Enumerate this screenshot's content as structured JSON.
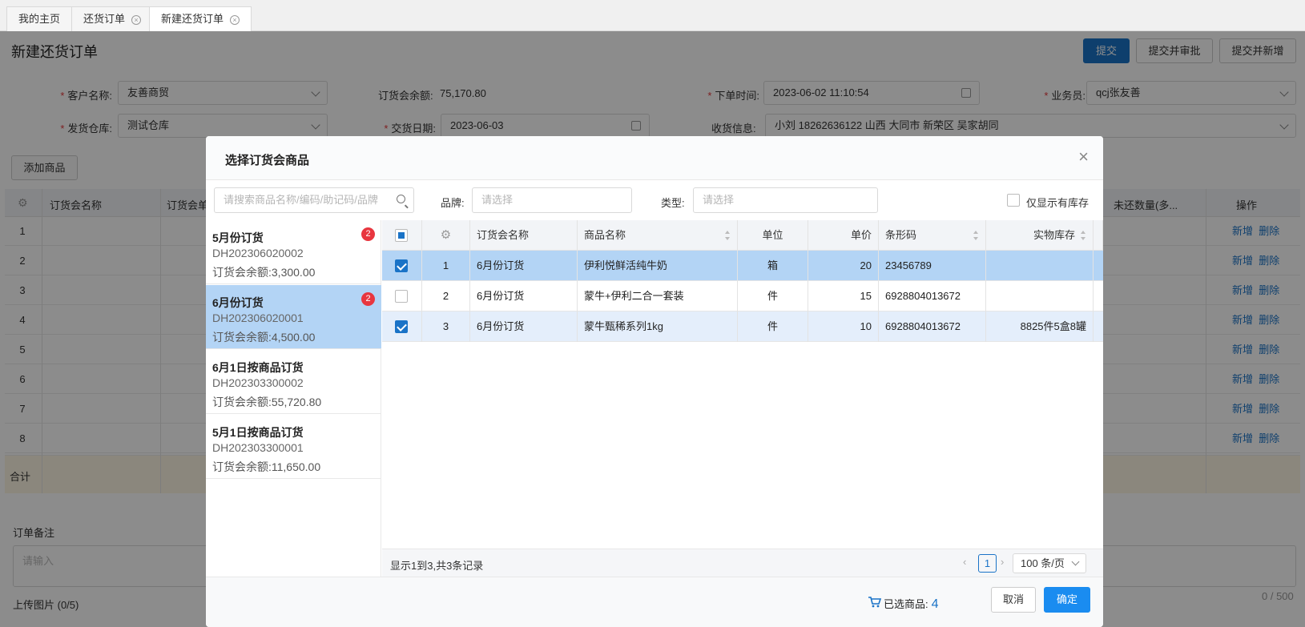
{
  "tabs": [
    {
      "label": "我的主页",
      "closable": false
    },
    {
      "label": "还货订单",
      "closable": true
    },
    {
      "label": "新建还货订单",
      "closable": true,
      "active": true
    }
  ],
  "page": {
    "title": "新建还货订单",
    "buttons": {
      "submit": "提交",
      "submit_approve": "提交并审批",
      "submit_new": "提交并新增"
    },
    "form": {
      "customer_label": "客户名称:",
      "customer_value": "友善商贸",
      "balance_label": "订货会余额:",
      "balance_value": "75,170.80",
      "order_time_label": "下单时间:",
      "order_time_value": "2023-06-02 11:10:54",
      "salesman_label": "业务员:",
      "salesman_value": "qcj张友善",
      "warehouse_label": "发货仓库:",
      "warehouse_value": "测试仓库",
      "delivery_date_label": "交货日期:",
      "delivery_date_value": "2023-06-03",
      "receive_label": "收货信息:",
      "receive_value": "小刘 18262636122 山西 大同市 新荣区 吴家胡同"
    },
    "add_product": "添加商品",
    "grid_headers": {
      "name": "订货会名称",
      "name2": "订货会单",
      "unreturned": "未还数量(多...",
      "ops": "操作"
    },
    "row_numbers": [
      "1",
      "2",
      "3",
      "4",
      "5",
      "6",
      "7",
      "8"
    ],
    "row_ops": {
      "add": "新增",
      "delete": "删除"
    },
    "sum_label": "合计",
    "remark_label": "订单备注",
    "remark_placeholder": "请输入",
    "remark_count": "0 / 500",
    "upload_label": "上传图片 (0/5)"
  },
  "modal": {
    "title": "选择订货会商品",
    "search_placeholder": "请搜索商品名称/编码/助记码/品牌",
    "brand_label": "品牌:",
    "brand_placeholder": "请选择",
    "type_label": "类型:",
    "type_placeholder": "请选择",
    "stock_only_label": "仅显示有库存",
    "events": [
      {
        "name": "5月份订货",
        "code": "DH202306020002",
        "balance": "订货会余额:3,300.00",
        "badge": "2",
        "selected": false
      },
      {
        "name": "6月份订货",
        "code": "DH202306020001",
        "balance": "订货会余额:4,500.00",
        "badge": "2",
        "selected": true
      },
      {
        "name": "6月1日按商品订货",
        "code": "DH202303300002",
        "balance": "订货会余额:55,720.80",
        "badge": "",
        "selected": false
      },
      {
        "name": "5月1日按商品订货",
        "code": "DH202303300001",
        "balance": "订货会余额:11,650.00",
        "badge": "",
        "selected": false
      }
    ],
    "columns": {
      "event": "订货会名称",
      "product": "商品名称",
      "unit": "单位",
      "price": "单价",
      "barcode": "条形码",
      "stock": "实物库存"
    },
    "rows": [
      {
        "idx": "1",
        "event": "6月份订货",
        "product": "伊利悦鲜活纯牛奶",
        "unit": "箱",
        "price": "20",
        "barcode": "23456789",
        "stock": "",
        "checked": true
      },
      {
        "idx": "2",
        "event": "6月份订货",
        "product": "蒙牛+伊利二合一套装",
        "unit": "件",
        "price": "15",
        "barcode": "6928804013672",
        "stock": "",
        "checked": false
      },
      {
        "idx": "3",
        "event": "6月份订货",
        "product": "蒙牛甄稀系列1kg",
        "unit": "件",
        "price": "10",
        "barcode": "6928804013672",
        "stock": "8825件5盒8罐",
        "checked": true
      }
    ],
    "pagination": {
      "info": "显示1到3,共3条记录",
      "page": "1",
      "page_size": "100 条/页"
    },
    "footer": {
      "selected_label": "已选商品:",
      "selected_count": "4",
      "cancel": "取消",
      "confirm": "确定"
    }
  },
  "colors": {
    "primary": "#1a73c7",
    "confirm": "#1a8cf0",
    "badge": "#e8363f",
    "selected_row": "#b3d4f5"
  }
}
